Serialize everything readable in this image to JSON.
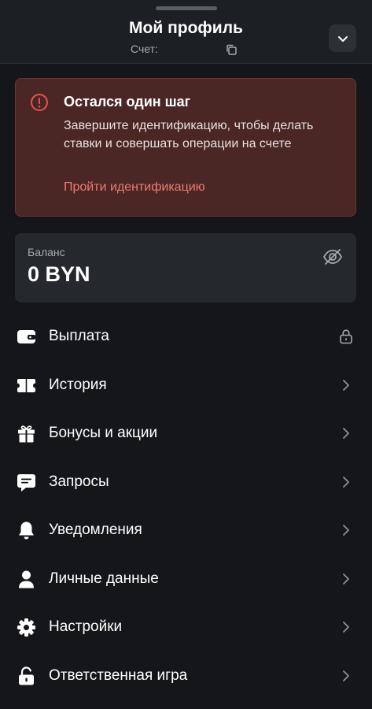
{
  "header": {
    "title": "Мой профиль",
    "account_label": "Счет:",
    "icons": [
      "copy-icon",
      "chevron-down-icon"
    ]
  },
  "warning": {
    "title": "Остался один шаг",
    "text": "Завершите идентификацию, чтобы делать ставки и совершать операции на счете",
    "link": "Пройти идентификацию",
    "icon": "alert-circle-icon",
    "colors": {
      "background": "#4a2624",
      "accent": "#e0574b",
      "link": "#ef7b72"
    }
  },
  "balance": {
    "label": "Баланс",
    "value": "0 BYN",
    "icon": "eye-off-icon"
  },
  "menu": {
    "items": [
      {
        "label": "Выплата",
        "icon": "wallet-icon",
        "trailing": "lock-icon"
      },
      {
        "label": "История",
        "icon": "ticket-icon",
        "trailing": "chevron-right-icon"
      },
      {
        "label": "Бонусы и акции",
        "icon": "gift-icon",
        "trailing": "chevron-right-icon"
      },
      {
        "label": "Запросы",
        "icon": "chat-icon",
        "trailing": "chevron-right-icon"
      },
      {
        "label": "Уведомления",
        "icon": "bell-icon",
        "trailing": "chevron-right-icon"
      },
      {
        "label": "Личные данные",
        "icon": "user-icon",
        "trailing": "chevron-right-icon"
      },
      {
        "label": "Настройки",
        "icon": "gear-icon",
        "trailing": "chevron-right-icon"
      },
      {
        "label": "Ответственная игра",
        "icon": "unlock-icon",
        "trailing": "chevron-right-icon"
      }
    ]
  },
  "colors": {
    "background": "#151619",
    "header": "#1c1f23",
    "card": "#25282c",
    "muted_text": "#a7abb1"
  }
}
